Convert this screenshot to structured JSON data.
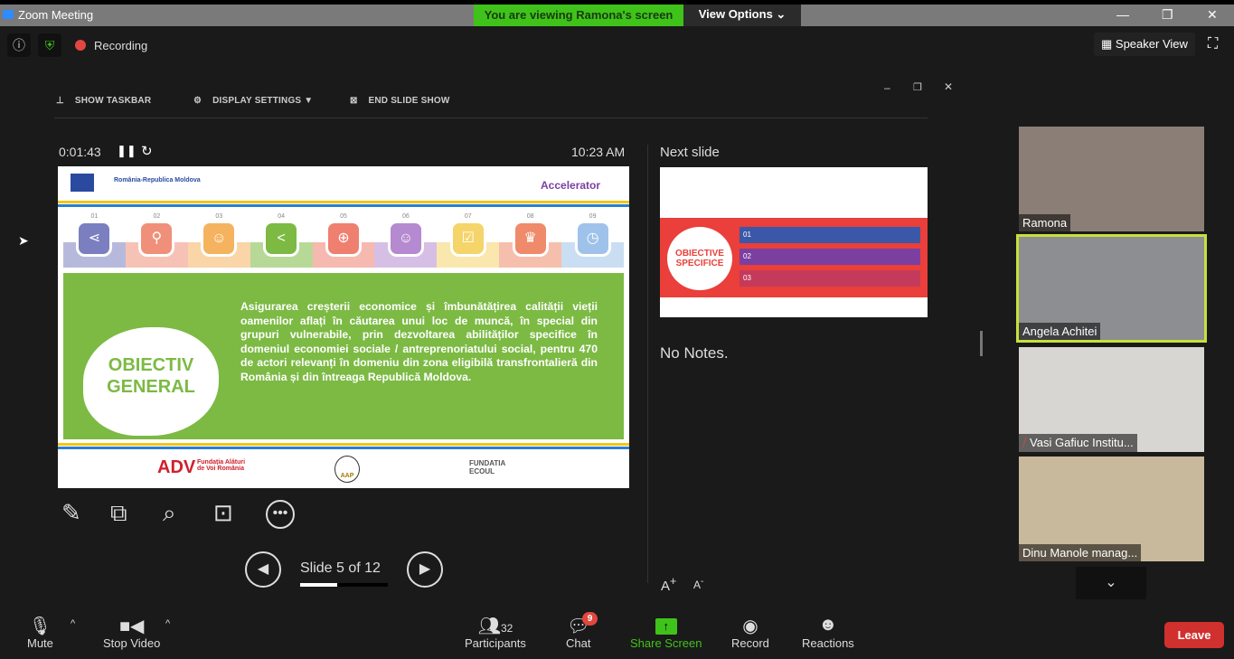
{
  "window": {
    "title": "Zoom Meeting",
    "viewing_banner": "You are viewing Ramona's screen",
    "view_options": "View Options ⌄"
  },
  "meeting": {
    "recording": "Recording",
    "speaker_view": "Speaker View"
  },
  "presenter_toolbar": {
    "show_taskbar": "SHOW TASKBAR",
    "display_settings": "DISPLAY SETTINGS ▼",
    "end_slide_show": "END SLIDE SHOW"
  },
  "presenter": {
    "elapsed": "0:01:43",
    "clock": "10:23 AM",
    "next_slide_label": "Next slide",
    "notes": "No Notes.",
    "slide_counter": "Slide 5 of 12",
    "progress_fraction": 0.42
  },
  "slide": {
    "header_left": "România-Republica Moldova",
    "brand": "Accelerator",
    "steps": [
      {
        "n": "01",
        "c": "#7b7fc0",
        "i": "⋖"
      },
      {
        "n": "02",
        "c": "#f0907a",
        "i": "⚲"
      },
      {
        "n": "03",
        "c": "#f5b35f",
        "i": "☺"
      },
      {
        "n": "04",
        "c": "#7cba44",
        "i": "<"
      },
      {
        "n": "05",
        "c": "#ef7f6f",
        "i": "⊕"
      },
      {
        "n": "06",
        "c": "#b58ad0",
        "i": "☺"
      },
      {
        "n": "07",
        "c": "#f5d46a",
        "i": "☑"
      },
      {
        "n": "08",
        "c": "#ef8b6a",
        "i": "♛"
      },
      {
        "n": "09",
        "c": "#9fc2ea",
        "i": "◷"
      }
    ],
    "heading": "OBIECTIV GENERAL",
    "body": "Asigurarea creșterii economice și îmbunătățirea calității vieții oamenilor aflați în căutarea unui loc de muncă, în special din grupuri vulnerabile, prin dezvoltarea abilităților specifice în domeniul economiei sociale / antreprenoriatului social, pentru 470 de actori relevanți în domeniu din zona eligibilă transfrontalieră din România și din întreaga Republică Moldova.",
    "footer": {
      "adv": "ADV",
      "adv_sub": "Fundația Alături de Voi România",
      "aap": "AAP",
      "ecoul": "FUNDATIA ECOUL"
    }
  },
  "next_slide": {
    "heading": "OBIECTIVE SPECIFICE",
    "items": [
      "01",
      "02",
      "03"
    ]
  },
  "participants": [
    {
      "name": "Ramona"
    },
    {
      "name": "Angela Achitei"
    },
    {
      "name": "Vasi Gafiuc Institu..."
    },
    {
      "name": "Dinu Manole manag..."
    }
  ],
  "toolbar": {
    "mute": "Mute",
    "stop_video": "Stop Video",
    "participants": "Participants",
    "participants_count": "32",
    "chat": "Chat",
    "chat_badge": "9",
    "share_screen": "Share Screen",
    "record": "Record",
    "reactions": "Reactions",
    "leave": "Leave"
  }
}
